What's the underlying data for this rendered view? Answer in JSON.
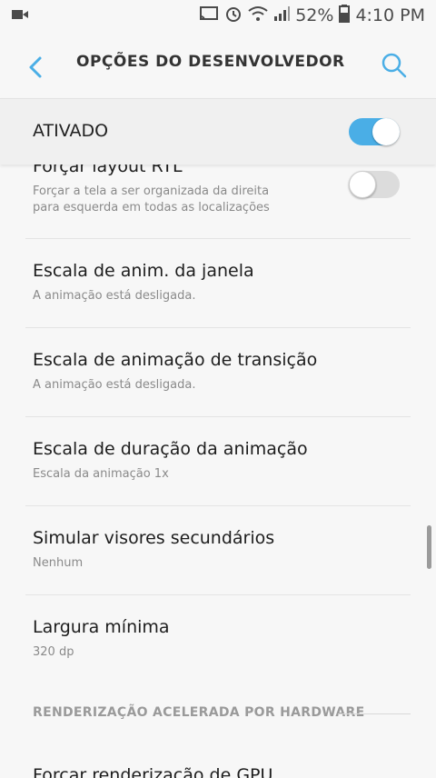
{
  "status_bar": {
    "battery_percent": "52%",
    "time": "4:10 PM",
    "icons": [
      "video-call-icon",
      "cast-icon",
      "alarm-icon",
      "wifi-icon",
      "signal-icon",
      "battery-icon"
    ]
  },
  "header": {
    "title": "OPÇÕES DO DESENVOLVEDOR",
    "back_icon": "chevron-left-icon",
    "search_icon": "search-icon"
  },
  "master_switch": {
    "label": "ATIVADO",
    "enabled": true
  },
  "items": [
    {
      "title": "Forçar layout RTL",
      "subtitle_line1": "Forçar a tela a ser organizada da direita",
      "subtitle_line2": "para esquerda em todas as localizações",
      "toggle": false
    },
    {
      "title": "Escala de anim. da janela",
      "subtitle": "A animação está desligada."
    },
    {
      "title": "Escala de animação de transição",
      "subtitle": "A animação está desligada."
    },
    {
      "title": "Escala de duração da animação",
      "subtitle": "Escala da animação 1x"
    },
    {
      "title": "Simular visores secundários",
      "subtitle": "Nenhum"
    },
    {
      "title": "Largura mínima",
      "subtitle": "320 dp"
    }
  ],
  "section": {
    "header": "RENDERIZAÇÃO ACELERADA POR HARDWARE"
  },
  "next_item": {
    "title": "Forçar renderização de GPU"
  },
  "colors": {
    "accent": "#4aaee6",
    "background": "#f7f7f7"
  }
}
